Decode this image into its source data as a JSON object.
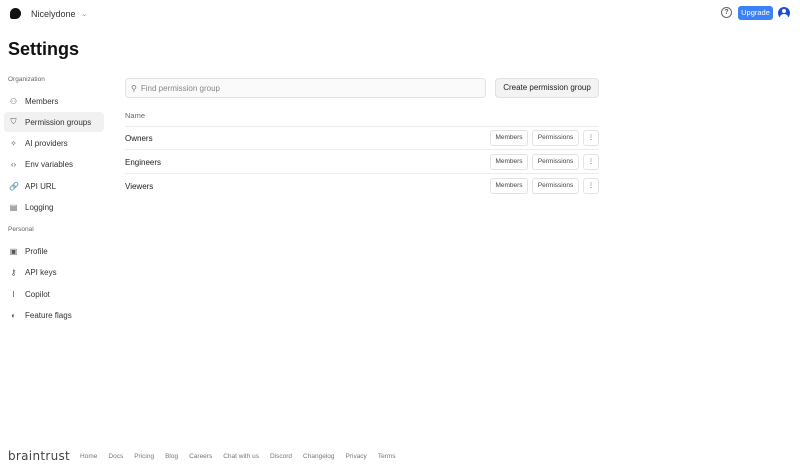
{
  "topbar": {
    "org_name": "Nicelydone",
    "upgrade_label": "Upgrade",
    "help_icon": "question-circle-icon"
  },
  "page_title": "Settings",
  "sidebar": {
    "sections": [
      {
        "label": "Organization",
        "items": [
          {
            "label": "Members",
            "icon": "users-icon",
            "glyph": "⚇"
          },
          {
            "label": "Permission groups",
            "icon": "shield-check-icon",
            "glyph": "⛉",
            "active": true
          },
          {
            "label": "AI providers",
            "icon": "sparkle-icon",
            "glyph": "✧"
          },
          {
            "label": "Env variables",
            "icon": "code-icon",
            "glyph": "‹›"
          },
          {
            "label": "API URL",
            "icon": "link-icon",
            "glyph": "🔗"
          },
          {
            "label": "Logging",
            "icon": "scroll-icon",
            "glyph": "▤"
          }
        ]
      },
      {
        "label": "Personal",
        "items": [
          {
            "label": "Profile",
            "icon": "user-square-icon",
            "glyph": "▣"
          },
          {
            "label": "API keys",
            "icon": "key-icon",
            "glyph": "⚷"
          },
          {
            "label": "Copilot",
            "icon": "text-cursor-icon",
            "glyph": "I"
          },
          {
            "label": "Feature flags",
            "icon": "toggle-icon",
            "glyph": "◐"
          }
        ]
      }
    ]
  },
  "main": {
    "search_placeholder": "Find permission group",
    "create_label": "Create permission group",
    "column_name": "Name",
    "row_members_label": "Members",
    "row_permissions_label": "Permissions",
    "rows": [
      {
        "name": "Owners"
      },
      {
        "name": "Engineers"
      },
      {
        "name": "Viewers"
      }
    ]
  },
  "footer": {
    "brand": "braintrust",
    "links": [
      "Home",
      "Docs",
      "Pricing",
      "Blog",
      "Careers",
      "Chat with us",
      "Discord",
      "Changelog",
      "Privacy",
      "Terms"
    ]
  }
}
